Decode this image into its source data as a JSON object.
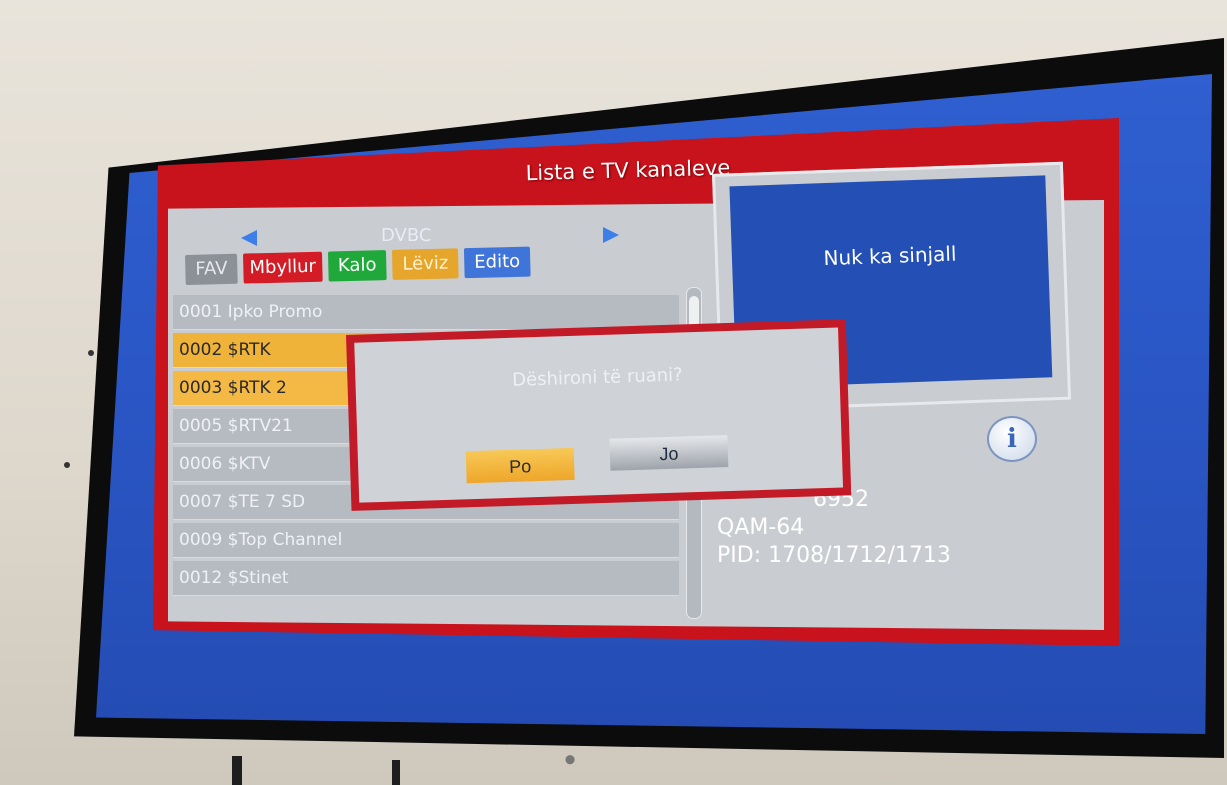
{
  "window": {
    "title": "Lista e TV kanaleve"
  },
  "list": {
    "band": "DVBC",
    "tabs": [
      "FAV",
      "Mbyllur",
      "Kalo",
      "Lëviz",
      "Edito"
    ],
    "channels": [
      {
        "label": "0001 Ipko Promo",
        "state": "normal"
      },
      {
        "label": "0002 $RTK",
        "state": "selected"
      },
      {
        "label": "0003 $RTK 2",
        "state": "marked"
      },
      {
        "label": "0005 $RTV21",
        "state": "normal"
      },
      {
        "label": "0006 $KTV",
        "state": "normal"
      },
      {
        "label": "0007 $TE 7 SD",
        "state": "normal"
      },
      {
        "label": "0009 $Top Channel",
        "state": "normal"
      },
      {
        "label": "0012 $Stinet",
        "state": "normal"
      }
    ]
  },
  "preview": {
    "status": "Nuk ka sinjall"
  },
  "info": {
    "line1": "6952",
    "line2": "QAM-64",
    "line3": "PID: 1708/1712/1713"
  },
  "dialog": {
    "question": "Dëshironi të ruani?",
    "yes_label": "Po",
    "no_label": "Jo"
  },
  "colors": {
    "screen_blue": "#2a56c5",
    "accent_red": "#c8121c",
    "highlight_orange": "#f0b33a"
  }
}
